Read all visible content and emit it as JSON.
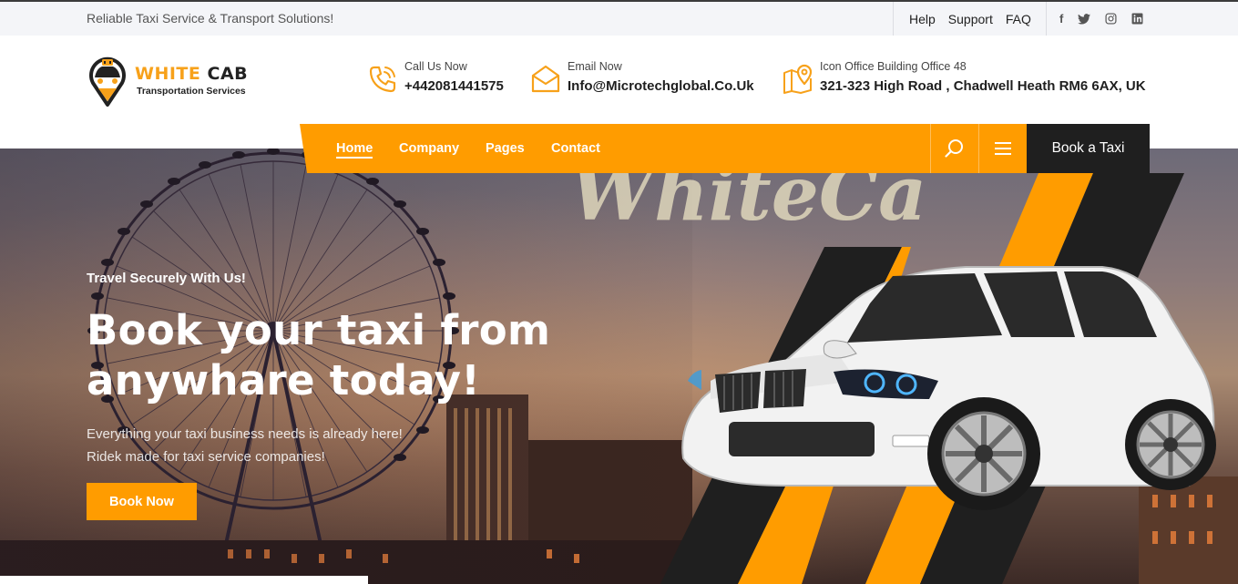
{
  "topbar": {
    "tagline": "Reliable Taxi Service & Transport Solutions!",
    "links": [
      "Help",
      "Support",
      "FAQ"
    ],
    "social": [
      {
        "icon": "facebook-icon",
        "glyph": "f"
      },
      {
        "icon": "twitter-icon",
        "glyph": "🐦"
      },
      {
        "icon": "instagram-icon",
        "glyph": "◎"
      },
      {
        "icon": "linkedin-icon",
        "glyph": "in"
      }
    ]
  },
  "logo": {
    "word1": "WHITE",
    "word2": "CAB",
    "subtitle": "Transportation Services"
  },
  "contacts": [
    {
      "icon": "phone-icon",
      "label": "Call Us Now",
      "value": "+442081441575"
    },
    {
      "icon": "email-icon",
      "label": "Email Now",
      "value": "Info@Microtechglobal.Co.Uk"
    },
    {
      "icon": "map-location-icon",
      "label": "Icon Office Building Office 48",
      "value": "321-323 High Road , Chadwell Heath RM6 6AX, UK"
    }
  ],
  "nav": {
    "items": [
      "Home",
      "Company",
      "Pages",
      "Contact"
    ],
    "active": "Home",
    "cta": "Book a Taxi"
  },
  "hero": {
    "kicker": "Travel Securely With Us!",
    "headline_line1": "Book your taxi from",
    "headline_line2": "anywhare today!",
    "para_line1": "Everything your taxi business needs is already here!",
    "para_line2": "Ridek made for taxi service companies!",
    "cta": "Book Now",
    "watermark": "WhiteCab"
  },
  "colors": {
    "accent": "#ff9c00",
    "dark": "#1f1f1f",
    "topbar_bg": "#f4f5f8"
  }
}
